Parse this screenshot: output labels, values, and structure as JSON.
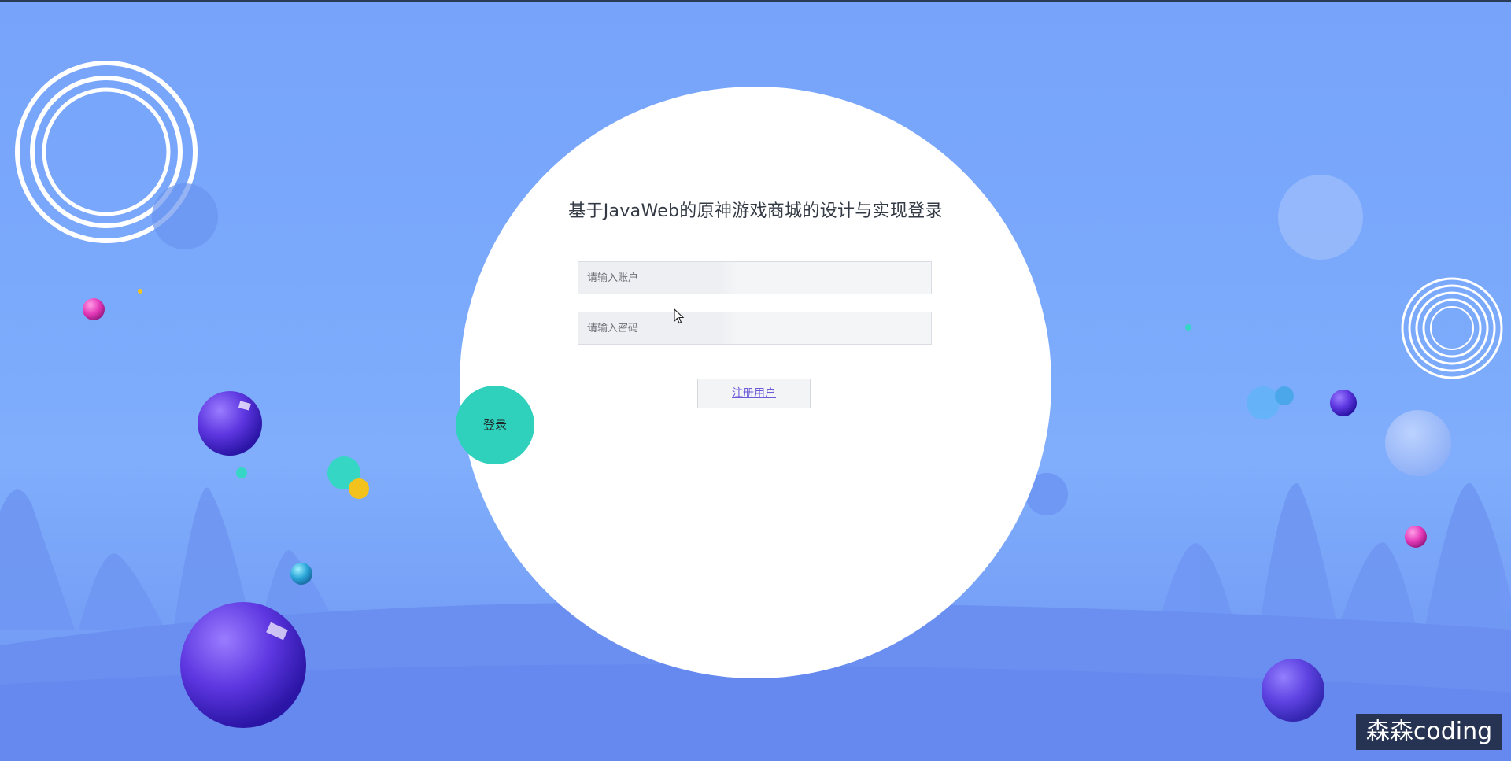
{
  "page": {
    "title": "基于JavaWeb的原神游戏商城的设计与实现登录"
  },
  "form": {
    "account_placeholder": "请输入账户",
    "password_placeholder": "请输入密码",
    "register_label": "注册用户",
    "login_label": "登录"
  },
  "watermark": {
    "text": "森森coding"
  },
  "colors": {
    "background": "#7aa8fb",
    "login_button": "#2fd0bc",
    "register_link": "#6a5bd8",
    "card": "#ffffff"
  },
  "icons": {
    "cursor": "mouse-pointer-icon"
  }
}
